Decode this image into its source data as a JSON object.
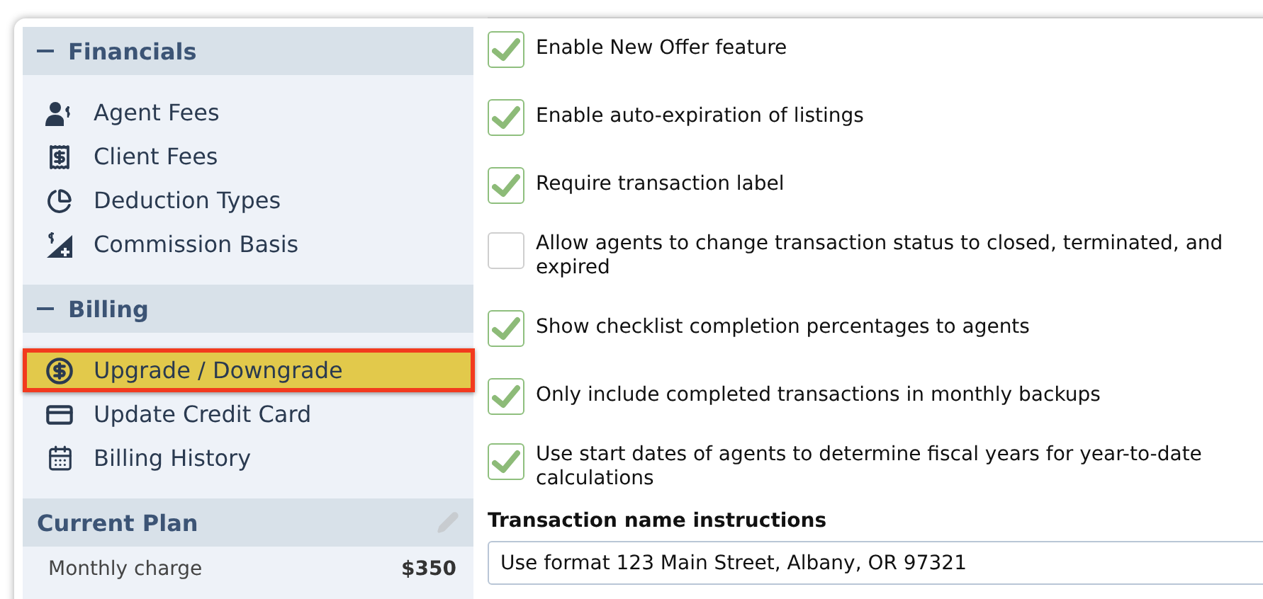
{
  "sidebar": {
    "sections": [
      {
        "kind": "menu",
        "title": "Financials",
        "expanded": true,
        "items": [
          {
            "label": "Agent Fees",
            "kind": "agent",
            "selected": false
          },
          {
            "label": "Client Fees",
            "kind": "receipt",
            "selected": false
          },
          {
            "label": "Deduction Types",
            "kind": "pie",
            "selected": false
          },
          {
            "label": "Commission Basis",
            "kind": "basis",
            "selected": false
          }
        ]
      },
      {
        "kind": "menu",
        "title": "Billing",
        "expanded": true,
        "items": [
          {
            "label": "Upgrade / Downgrade",
            "kind": "dollar",
            "selected": true
          },
          {
            "label": "Update Credit Card",
            "kind": "card",
            "selected": false
          },
          {
            "label": "Billing History",
            "kind": "calendar",
            "selected": false
          }
        ]
      },
      {
        "kind": "plan",
        "title": "Current Plan",
        "rows": [
          {
            "label": "Monthly charge",
            "value": "$350"
          }
        ]
      }
    ]
  },
  "settings": [
    {
      "label": "Enable New Offer feature",
      "checked": true
    },
    {
      "label": "Enable auto-expiration of listings",
      "checked": true
    },
    {
      "label": "Require transaction label",
      "checked": true
    },
    {
      "label": "Allow agents to change transaction status to closed, terminated, and expired",
      "checked": false
    },
    {
      "label": "Show checklist completion percentages to agents",
      "checked": true
    },
    {
      "label": "Only include completed transactions in monthly backups",
      "checked": true
    },
    {
      "label": "Use start dates of agents to determine fiscal years for year-to-date calculations",
      "checked": true
    }
  ],
  "name_instructions": {
    "label": "Transaction name instructions",
    "value": "Use format 123 Main Street, Albany, OR 97321"
  }
}
